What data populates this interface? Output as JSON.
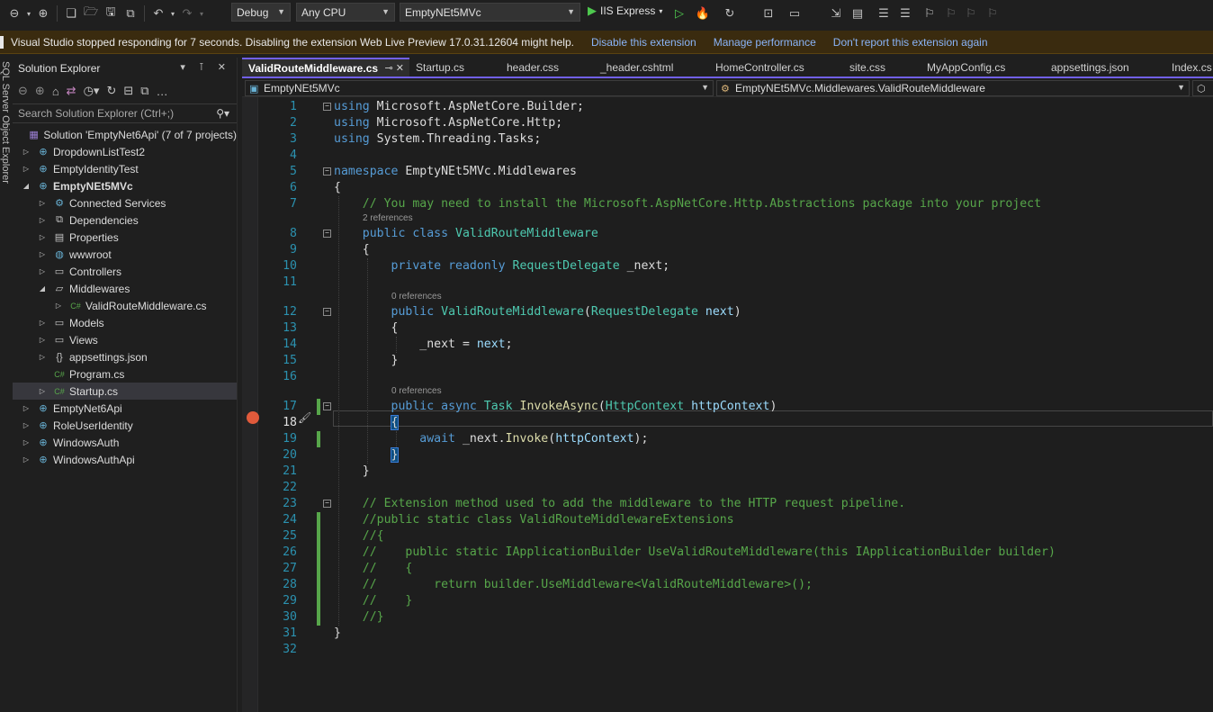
{
  "toolbar": {
    "config": "Debug",
    "platform": "Any CPU",
    "startup_project": "EmptyNEt5MVc",
    "run_target": "IIS Express"
  },
  "infobar": {
    "message": "Visual Studio stopped responding for 7 seconds. Disabling the extension Web Live Preview 17.0.31.12604 might help.",
    "link_disable": "Disable this extension",
    "link_manage": "Manage performance",
    "link_dont_report": "Don't report this extension again"
  },
  "side_strip": {
    "label": "SQL Server Object Explorer"
  },
  "solution_explorer": {
    "title": "Solution Explorer",
    "search_placeholder": "Search Solution Explorer (Ctrl+;)",
    "items": [
      {
        "label": "Solution 'EmptyNet6Api' (7 of 7 projects)",
        "icon": "solution-icon"
      },
      {
        "label": "DropdownListTest2",
        "icon": "web-project-icon"
      },
      {
        "label": "EmptyIdentityTest",
        "icon": "web-project-icon"
      },
      {
        "label": "EmptyNEt5MVc",
        "icon": "web-project-icon"
      },
      {
        "label": "Connected Services",
        "icon": "connected-services-icon"
      },
      {
        "label": "Dependencies",
        "icon": "dependencies-icon"
      },
      {
        "label": "Properties",
        "icon": "properties-icon"
      },
      {
        "label": "wwwroot",
        "icon": "globe-icon"
      },
      {
        "label": "Controllers",
        "icon": "folder-icon"
      },
      {
        "label": "Middlewares",
        "icon": "folder-open-icon"
      },
      {
        "label": "ValidRouteMiddleware.cs",
        "icon": "csharp-file-icon"
      },
      {
        "label": "Models",
        "icon": "folder-icon"
      },
      {
        "label": "Views",
        "icon": "folder-icon"
      },
      {
        "label": "appsettings.json",
        "icon": "json-file-icon"
      },
      {
        "label": "Program.cs",
        "icon": "csharp-file-icon"
      },
      {
        "label": "Startup.cs",
        "icon": "csharp-file-icon"
      },
      {
        "label": "EmptyNet6Api",
        "icon": "web-project-icon"
      },
      {
        "label": "RoleUserIdentity",
        "icon": "web-project-icon"
      },
      {
        "label": "WindowsAuth",
        "icon": "web-project-icon"
      },
      {
        "label": "WindowsAuthApi",
        "icon": "web-project-icon"
      }
    ]
  },
  "tabs": [
    {
      "label": "ValidRouteMiddleware.cs"
    },
    {
      "label": "Startup.cs"
    },
    {
      "label": "header.css"
    },
    {
      "label": "_header.cshtml"
    },
    {
      "label": "HomeController.cs"
    },
    {
      "label": "site.css"
    },
    {
      "label": "MyAppConfig.cs"
    },
    {
      "label": "appsettings.json"
    },
    {
      "label": "Index.cshtml"
    }
  ],
  "navbar": {
    "project": "EmptyNEt5MVc",
    "type": "EmptyNEt5MVc.Middlewares.ValidRouteMiddleware"
  },
  "code": {
    "line_numbers": [
      "1",
      "2",
      "3",
      "4",
      "5",
      "6",
      "7",
      "8",
      "9",
      "10",
      "11",
      "12",
      "13",
      "14",
      "15",
      "16",
      "17",
      "18",
      "19",
      "20",
      "21",
      "22",
      "23",
      "24",
      "25",
      "26",
      "27",
      "28",
      "29",
      "30",
      "31",
      "32"
    ],
    "refs_2": "2 references",
    "refs_0": "0 references",
    "lines": [
      "using Microsoft.AspNetCore.Builder;",
      "using Microsoft.AspNetCore.Http;",
      "using System.Threading.Tasks;",
      "",
      "namespace EmptyNEt5MVc.Middlewares",
      "{",
      "    // You may need to install the Microsoft.AspNetCore.Http.Abstractions package into your project",
      "    public class ValidRouteMiddleware",
      "    {",
      "        private readonly RequestDelegate _next;",
      "",
      "        public ValidRouteMiddleware(RequestDelegate next)",
      "        {",
      "            _next = next;",
      "        }",
      "",
      "        public async Task InvokeAsync(HttpContext httpContext)",
      "        {",
      "            await _next.Invoke(httpContext);",
      "        }",
      "    }",
      "",
      "    // Extension method used to add the middleware to the HTTP request pipeline.",
      "    //public static class ValidRouteMiddlewareExtensions",
      "    //{",
      "    //    public static IApplicationBuilder UseValidRouteMiddleware(this IApplicationBuilder builder)",
      "    //    {",
      "    //        return builder.UseMiddleware<ValidRouteMiddleware>();",
      "    //    }",
      "    //}",
      "}",
      ""
    ]
  },
  "colors": {
    "accent": "#7160e8",
    "keyword": "#569cd6",
    "type": "#4ec9b0",
    "method": "#dcdcaa",
    "parameter": "#9cdcfe",
    "comment": "#57a64a",
    "breakpoint": "#e05a3b"
  }
}
